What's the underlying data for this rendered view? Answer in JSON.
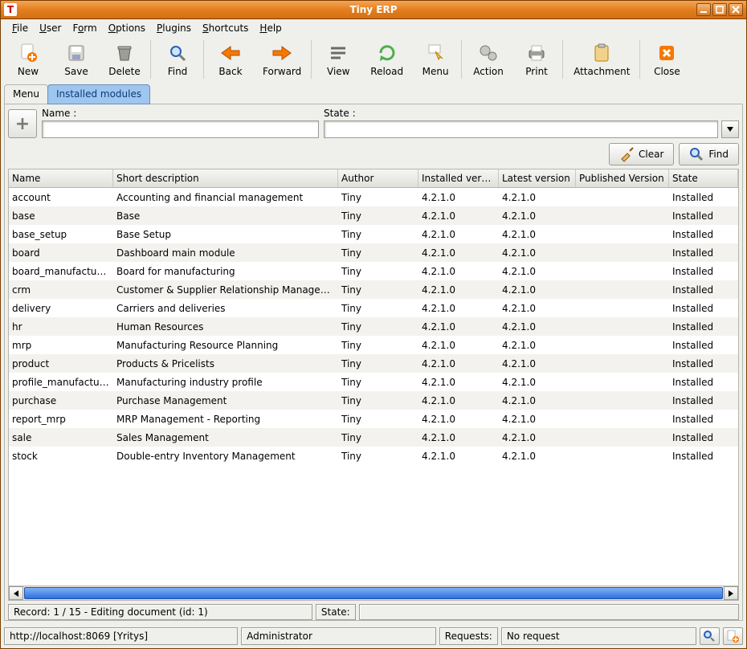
{
  "window": {
    "title": "Tiny ERP"
  },
  "menu": {
    "file": "File",
    "user": "User",
    "form": "Form",
    "options": "Options",
    "plugins": "Plugins",
    "shortcuts": "Shortcuts",
    "help": "Help"
  },
  "toolbar": {
    "new": "New",
    "save": "Save",
    "delete": "Delete",
    "find": "Find",
    "back": "Back",
    "forward": "Forward",
    "view": "View",
    "reload": "Reload",
    "menu": "Menu",
    "action": "Action",
    "print": "Print",
    "attachment": "Attachment",
    "close": "Close"
  },
  "tabs": {
    "menu": "Menu",
    "installed": "Installed modules"
  },
  "filters": {
    "name_label": "Name :",
    "state_label": "State :",
    "clear": "Clear",
    "find": "Find",
    "add": "+"
  },
  "columns": {
    "name": "Name",
    "short": "Short description",
    "author": "Author",
    "installed": "Installed version",
    "latest": "Latest version",
    "published": "Published Version",
    "state": "State"
  },
  "rows": [
    {
      "name": "account",
      "short": "Accounting and financial management",
      "author": "Tiny",
      "installed": "4.2.1.0",
      "latest": "4.2.1.0",
      "published": "",
      "state": "Installed"
    },
    {
      "name": "base",
      "short": "Base",
      "author": "Tiny",
      "installed": "4.2.1.0",
      "latest": "4.2.1.0",
      "published": "",
      "state": "Installed"
    },
    {
      "name": "base_setup",
      "short": "Base Setup",
      "author": "Tiny",
      "installed": "4.2.1.0",
      "latest": "4.2.1.0",
      "published": "",
      "state": "Installed"
    },
    {
      "name": "board",
      "short": "Dashboard main module",
      "author": "Tiny",
      "installed": "4.2.1.0",
      "latest": "4.2.1.0",
      "published": "",
      "state": "Installed"
    },
    {
      "name": "board_manufacturing",
      "short": "Board for manufacturing",
      "author": "Tiny",
      "installed": "4.2.1.0",
      "latest": "4.2.1.0",
      "published": "",
      "state": "Installed"
    },
    {
      "name": "crm",
      "short": "Customer & Supplier Relationship Management",
      "author": "Tiny",
      "installed": "4.2.1.0",
      "latest": "4.2.1.0",
      "published": "",
      "state": "Installed"
    },
    {
      "name": "delivery",
      "short": "Carriers and deliveries",
      "author": "Tiny",
      "installed": "4.2.1.0",
      "latest": "4.2.1.0",
      "published": "",
      "state": "Installed"
    },
    {
      "name": "hr",
      "short": "Human Resources",
      "author": "Tiny",
      "installed": "4.2.1.0",
      "latest": "4.2.1.0",
      "published": "",
      "state": "Installed"
    },
    {
      "name": "mrp",
      "short": "Manufacturing Resource Planning",
      "author": "Tiny",
      "installed": "4.2.1.0",
      "latest": "4.2.1.0",
      "published": "",
      "state": "Installed"
    },
    {
      "name": "product",
      "short": "Products & Pricelists",
      "author": "Tiny",
      "installed": "4.2.1.0",
      "latest": "4.2.1.0",
      "published": "",
      "state": "Installed"
    },
    {
      "name": "profile_manufacturing",
      "short": "Manufacturing industry profile",
      "author": "Tiny",
      "installed": "4.2.1.0",
      "latest": "4.2.1.0",
      "published": "",
      "state": "Installed"
    },
    {
      "name": "purchase",
      "short": "Purchase Management",
      "author": "Tiny",
      "installed": "4.2.1.0",
      "latest": "4.2.1.0",
      "published": "",
      "state": "Installed"
    },
    {
      "name": "report_mrp",
      "short": "MRP Management - Reporting",
      "author": "Tiny",
      "installed": "4.2.1.0",
      "latest": "4.2.1.0",
      "published": "",
      "state": "Installed"
    },
    {
      "name": "sale",
      "short": "Sales Management",
      "author": "Tiny",
      "installed": "4.2.1.0",
      "latest": "4.2.1.0",
      "published": "",
      "state": "Installed"
    },
    {
      "name": "stock",
      "short": "Double-entry Inventory Management",
      "author": "Tiny",
      "installed": "4.2.1.0",
      "latest": "4.2.1.0",
      "published": "",
      "state": "Installed"
    }
  ],
  "status": {
    "record": "Record: 1 / 15 - Editing document (id: 1)",
    "state_label": "State:",
    "state_value": "",
    "url": "http://localhost:8069 [Yritys]",
    "user": "Administrator",
    "requests_label": "Requests:",
    "requests_value": "No request"
  }
}
